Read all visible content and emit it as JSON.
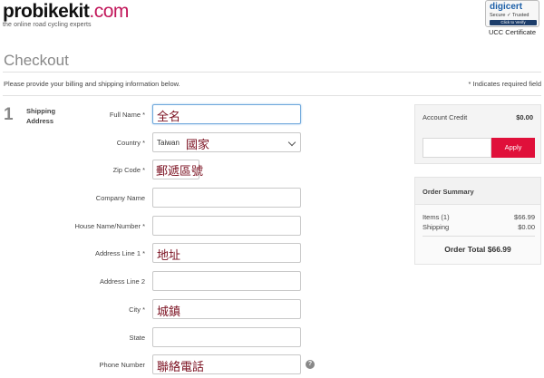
{
  "header": {
    "logo_main": "probikekit",
    "logo_tld": ".com",
    "logo_tagline": "the online road cycling experts",
    "cert_brand": "digicert",
    "cert_line": "Secure ✓ Trusted",
    "cert_click": "Click to Verify",
    "cert_caption": "UCC Certificate"
  },
  "page": {
    "title": "Checkout",
    "intro": "Please provide your billing and shipping information below.",
    "required_note": "* Indicates required field"
  },
  "step": {
    "number": "1",
    "label_line1": "Shipping",
    "label_line2": "Address"
  },
  "form": {
    "full_name": {
      "label": "Full Name *",
      "value": "全名"
    },
    "country": {
      "label": "Country *",
      "value_prefix": "Taiwan",
      "value": "國家"
    },
    "zip": {
      "label": "Zip Code *",
      "value": "郵遞區號"
    },
    "company": {
      "label": "Company Name",
      "value": ""
    },
    "house": {
      "label": "House Name/Number *",
      "value": ""
    },
    "address1": {
      "label": "Address Line 1 *",
      "value": "地址"
    },
    "address2": {
      "label": "Address Line 2",
      "value": ""
    },
    "city": {
      "label": "City *",
      "value": "城鎮"
    },
    "state": {
      "label": "State",
      "value": ""
    },
    "phone": {
      "label": "Phone Number",
      "value": "聯絡電話",
      "help": "?"
    }
  },
  "credit": {
    "label": "Account Credit",
    "amount": "$0.00",
    "apply_label": "Apply"
  },
  "summary": {
    "title": "Order Summary",
    "items_label": "Items (1)",
    "items_value": "$66.99",
    "shipping_label": "Shipping",
    "shipping_value": "$0.00",
    "total": "Order Total $66.99"
  },
  "colors": {
    "accent": "#e0103a",
    "brand": "#c2185b",
    "annotation": "#7b1020"
  }
}
